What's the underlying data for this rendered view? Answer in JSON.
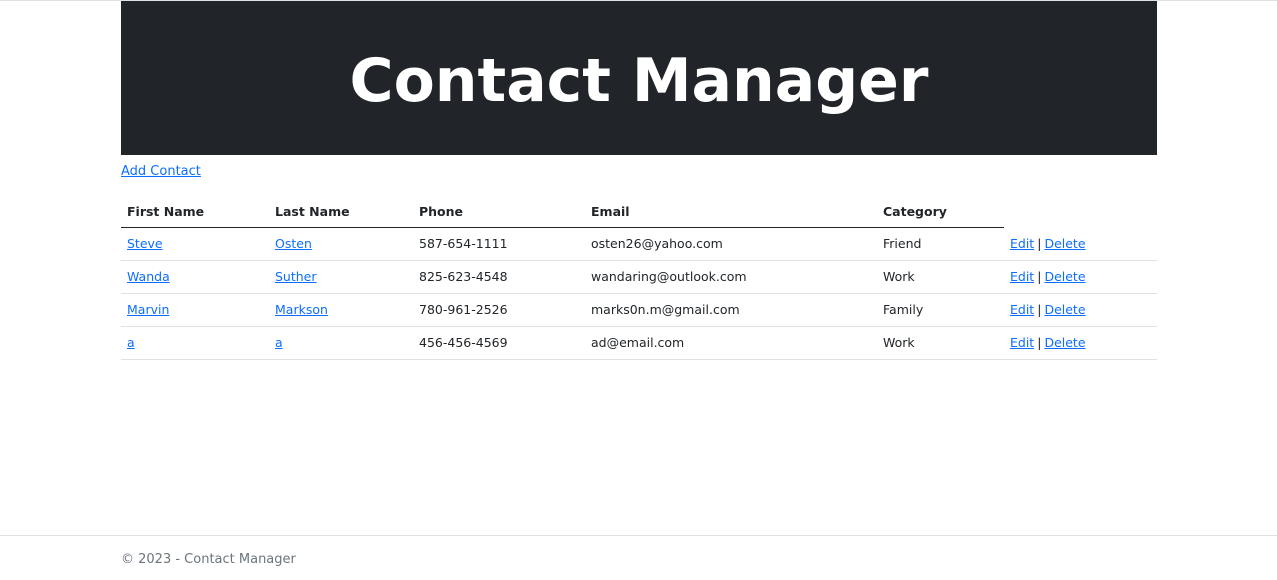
{
  "header": {
    "title": "Contact Manager"
  },
  "actions": {
    "add_contact": "Add Contact"
  },
  "table": {
    "columns": [
      "First Name",
      "Last Name",
      "Phone",
      "Email",
      "Category"
    ],
    "rows": [
      {
        "first": "Steve",
        "last": "Osten",
        "phone": "587-654-1111",
        "email": "osten26@yahoo.com",
        "category": "Friend",
        "edit": "Edit",
        "separator": "|",
        "delete": "Delete"
      },
      {
        "first": "Wanda",
        "last": "Suther",
        "phone": "825-623-4548",
        "email": "wandaring@outlook.com",
        "category": "Work",
        "edit": "Edit",
        "separator": "|",
        "delete": "Delete"
      },
      {
        "first": "Marvin",
        "last": "Markson",
        "phone": "780-961-2526",
        "email": "marks0n.m@gmail.com",
        "category": "Family",
        "edit": "Edit",
        "separator": "|",
        "delete": "Delete"
      },
      {
        "first": "a",
        "last": "a",
        "phone": "456-456-4569",
        "email": "ad@email.com",
        "category": "Work",
        "edit": "Edit",
        "separator": "|",
        "delete": "Delete"
      }
    ]
  },
  "footer": {
    "text": "© 2023 - Contact Manager"
  },
  "colors": {
    "header_bg": "#212529",
    "link": "#0d6efd",
    "muted": "#6c757d"
  }
}
